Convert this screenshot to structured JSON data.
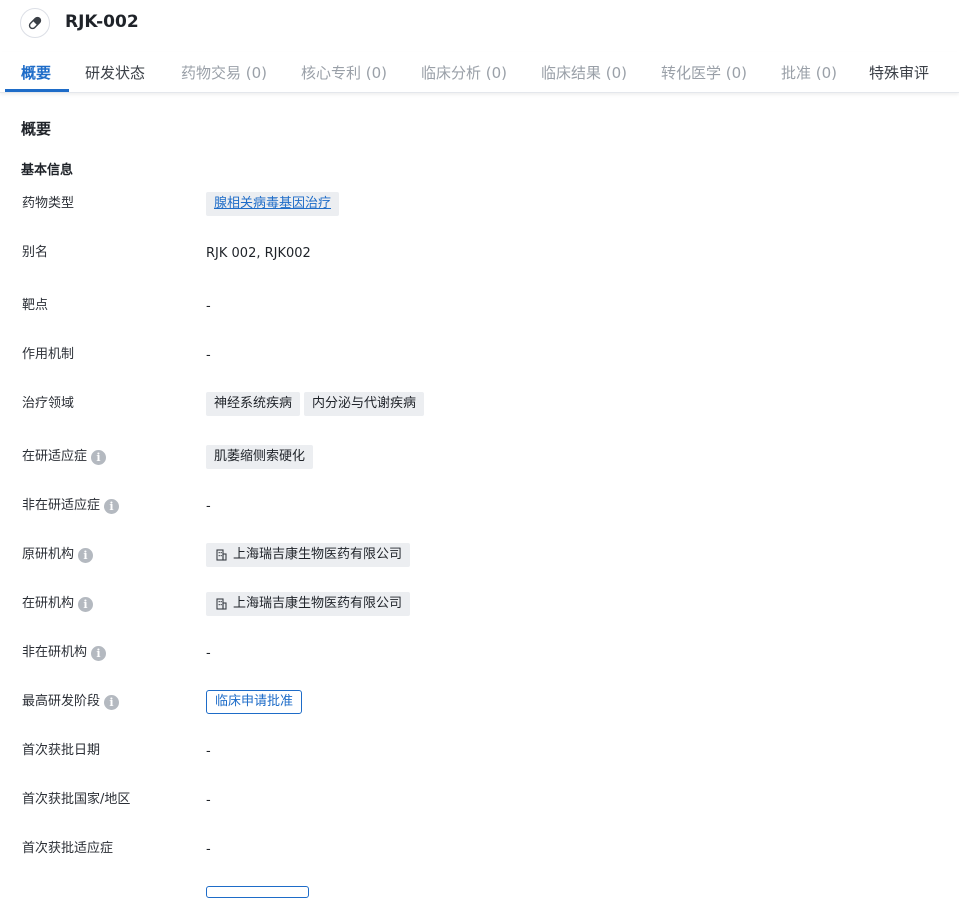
{
  "header": {
    "title": "RJK-002",
    "icon": "pill-icon"
  },
  "tabs": [
    {
      "label": "概要",
      "state": "active"
    },
    {
      "label": "研发状态",
      "state": "enabled"
    },
    {
      "label": "药物交易 (0)",
      "state": "disabled"
    },
    {
      "label": "核心专利 (0)",
      "state": "disabled"
    },
    {
      "label": "临床分析 (0)",
      "state": "disabled"
    },
    {
      "label": "临床结果 (0)",
      "state": "disabled"
    },
    {
      "label": "转化医学 (0)",
      "state": "disabled"
    },
    {
      "label": "批准 (0)",
      "state": "disabled"
    },
    {
      "label": "特殊审评",
      "state": "enabled"
    }
  ],
  "main": {
    "section_title": "概要",
    "subsection_title": "基本信息",
    "fields": {
      "drug_type": {
        "label": "药物类型",
        "tag": "腺相关病毒基因治疗"
      },
      "alias": {
        "label": "别名",
        "value": "RJK 002,  RJK002"
      },
      "target": {
        "label": "靶点",
        "value": "-"
      },
      "mechanism": {
        "label": "作用机制",
        "value": "-"
      },
      "therapeutic_area": {
        "label": "治疗领域",
        "tags": [
          "神经系统疾病",
          "内分泌与代谢疾病"
        ]
      },
      "active_indication": {
        "label": "在研适应症",
        "tags": [
          "肌萎缩侧索硬化"
        ]
      },
      "inactive_indication": {
        "label": "非在研适应症",
        "value": "-"
      },
      "originator": {
        "label": "原研机构",
        "org": "上海瑞吉康生物医药有限公司"
      },
      "active_org": {
        "label": "在研机构",
        "org": "上海瑞吉康生物医药有限公司"
      },
      "inactive_org": {
        "label": "非在研机构",
        "value": "-"
      },
      "highest_phase": {
        "label": "最高研发阶段",
        "tag": "临床申请批准"
      },
      "first_approval_date": {
        "label": "首次获批日期",
        "value": "-"
      },
      "first_approval_country": {
        "label": "首次获批国家/地区",
        "value": "-"
      },
      "first_approval_indication": {
        "label": "首次获批适应症",
        "value": "-"
      }
    }
  },
  "colors": {
    "accent": "#1e6cc8",
    "tag_bg": "#eceef1",
    "disabled_tab": "#9aa0a8"
  },
  "icons": {
    "info": "info-icon",
    "organization": "building-icon"
  }
}
